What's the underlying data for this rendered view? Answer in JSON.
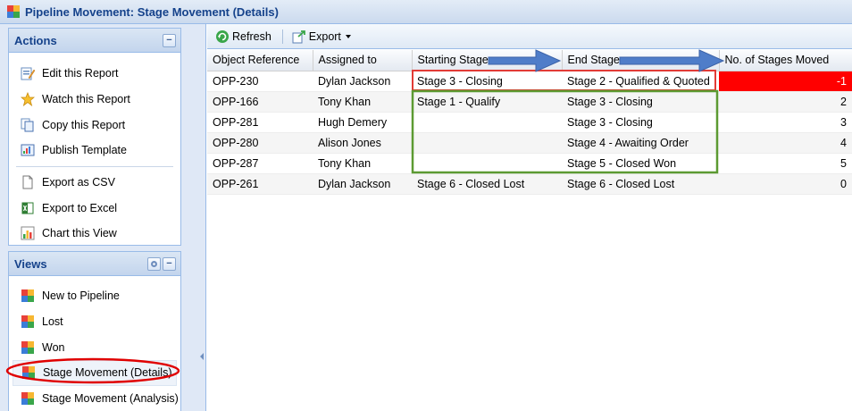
{
  "window": {
    "title": "Pipeline Movement: Stage Movement (Details)"
  },
  "actions": {
    "header": "Actions",
    "items": [
      {
        "label": "Edit this Report",
        "icon": "edit-report-icon"
      },
      {
        "label": "Watch this Report",
        "icon": "star-icon"
      },
      {
        "label": "Copy this Report",
        "icon": "copy-icon"
      },
      {
        "label": "Publish Template",
        "icon": "publish-icon"
      },
      {
        "label": "Export as CSV",
        "icon": "csv-icon"
      },
      {
        "label": "Export to Excel",
        "icon": "excel-icon"
      },
      {
        "label": "Chart this View",
        "icon": "chart-icon"
      }
    ]
  },
  "views": {
    "header": "Views",
    "items": [
      {
        "label": "New to Pipeline"
      },
      {
        "label": "Lost"
      },
      {
        "label": "Won"
      },
      {
        "label": "Stage Movement (Details)"
      },
      {
        "label": "Stage Movement (Analysis)"
      }
    ]
  },
  "toolbar": {
    "refresh": "Refresh",
    "export": "Export"
  },
  "grid": {
    "columns": [
      "Object Reference",
      "Assigned to",
      "Starting Stage",
      "End Stage",
      "No. of Stages Moved"
    ],
    "rows": [
      [
        "OPP-230",
        "Dylan Jackson",
        "Stage 3 - Closing",
        "Stage 2 - Qualified & Quoted",
        "-1"
      ],
      [
        "OPP-166",
        "Tony Khan",
        "Stage 1 - Qualify",
        "Stage 3 - Closing",
        "2"
      ],
      [
        "OPP-281",
        "Hugh Demery",
        "",
        "Stage 3 - Closing",
        "3"
      ],
      [
        "OPP-280",
        "Alison Jones",
        "",
        "Stage 4 - Awaiting Order",
        "4"
      ],
      [
        "OPP-287",
        "Tony Khan",
        "",
        "Stage 5 - Closed Won",
        "5"
      ],
      [
        "OPP-261",
        "Dylan Jackson",
        "Stage 6 - Closed Lost",
        "Stage 6 - Closed Lost",
        "0"
      ]
    ]
  },
  "colors": {
    "negative_highlight": "#ff0000",
    "red_outline": "#e23b36",
    "green_outline": "#5c9a32",
    "arrow_blue": "#4f7dc9"
  }
}
